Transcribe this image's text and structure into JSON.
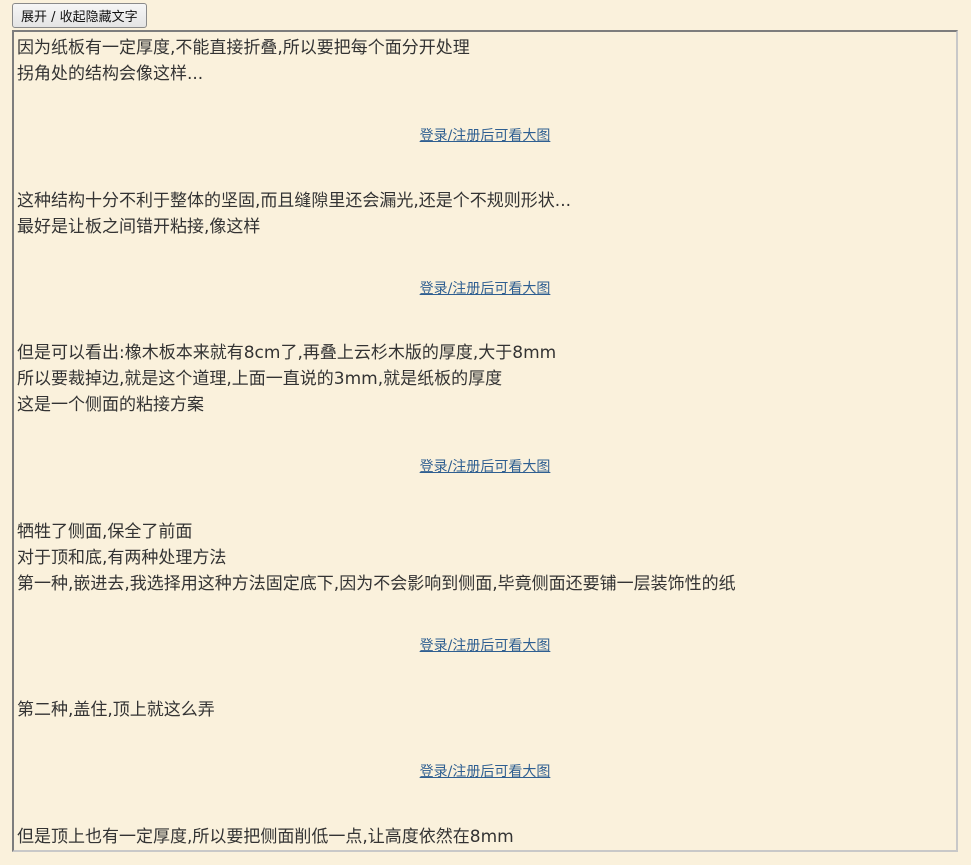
{
  "toggle_button": {
    "label": "展开 / 收起隐藏文字"
  },
  "image_link_label": "登录/注册后可看大图",
  "paragraphs": [
    [
      "因为纸板有一定厚度,不能直接折叠,所以要把每个面分开处理",
      "拐角处的结构会像这样..."
    ],
    [
      "这种结构十分不利于整体的坚固,而且缝隙里还会漏光,还是个不规则形状...",
      "最好是让板之间错开粘接,像这样"
    ],
    [
      "但是可以看出:橡木板本来就有8cm了,再叠上云杉木版的厚度,大于8mm",
      "所以要裁掉边,就是这个道理,上面一直说的3mm,就是纸板的厚度",
      "这是一个侧面的粘接方案"
    ],
    [
      "牺牲了侧面,保全了前面",
      "对于顶和底,有两种处理方法",
      "第一种,嵌进去,我选择用这种方法固定底下,因为不会影响到侧面,毕竟侧面还要铺一层装饰性的纸"
    ],
    [
      "第二种,盖住,顶上就这么弄"
    ],
    [
      "但是顶上也有一定厚度,所以要把侧面削低一点,让高度依然在8mm"
    ]
  ]
}
